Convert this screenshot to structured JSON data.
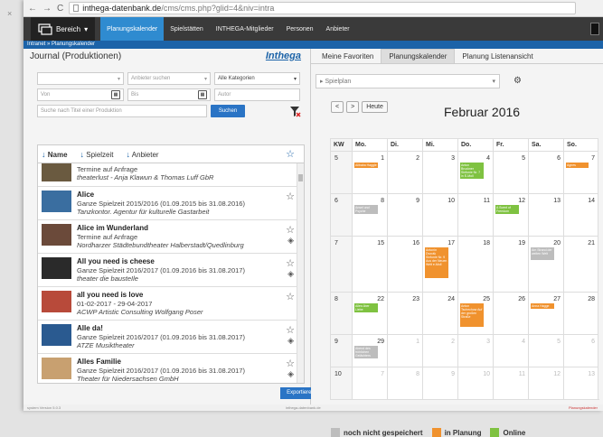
{
  "browser": {
    "url_domain": "inthega-datenbank.de",
    "url_path": "/cms/cms.php?glid=4&niv=intra",
    "close_glyph": "×"
  },
  "nav": {
    "brand_label": "Bereich",
    "items": [
      {
        "label": "Planungskalender",
        "active": true
      },
      {
        "label": "Spielstätten",
        "active": false
      },
      {
        "label": "INTHEGA-Mitglieder",
        "active": false
      },
      {
        "label": "Personen",
        "active": false
      },
      {
        "label": "Anbieter",
        "active": false
      }
    ]
  },
  "breadcrumb": "Intranet » Planungskalender",
  "journal": {
    "title": "Journal (Produktionen)",
    "logo": "Inthega",
    "filters": {
      "anbieter_placeholder": "Anbieter suchen",
      "kategorie_value": "Alle Kategorien",
      "von_placeholder": "Von",
      "bis_placeholder": "Bis",
      "autor_placeholder": "Autor",
      "titel_placeholder": "Suche nach Titel einer Produktion",
      "search_label": "Suchen"
    },
    "columns": {
      "name": "Name",
      "spielzeit": "Spielzeit",
      "anbieter": "Anbieter"
    },
    "items": [
      {
        "title": "",
        "line": "Termine auf Anfrage",
        "org": "theaterlust - Anja Klawun & Thomas Luff GbR",
        "thumb": "#6a5a40",
        "diamond": false
      },
      {
        "title": "Alice",
        "line": "Ganze Spielzeit 2015/2016 (01.09.2015 bis 31.08.2016)",
        "org": "Tanzkontor. Agentur für kulturelle Gastarbeit",
        "thumb": "#3a6ea0",
        "diamond": false
      },
      {
        "title": "Alice im Wunderland",
        "line": "Termine auf Anfrage",
        "org": "Nordharzer Städtebundtheater Halberstadt/Quedlinburg",
        "thumb": "#6b4a3a",
        "diamond": true
      },
      {
        "title": "All you need is cheese",
        "line": "Ganze Spielzeit 2016/2017 (01.09.2016 bis 31.08.2017)",
        "org": "theater die bausteIle",
        "thumb": "#2a2a2a",
        "diamond": true
      },
      {
        "title": "all you need is love",
        "line": "01-02-2017 - 29-04-2017",
        "org": "ACWP Artistic Consulting Wolfgang Poser",
        "thumb": "#b84a3a",
        "diamond": false
      },
      {
        "title": "Alle da!",
        "line": "Ganze Spielzeit 2016/2017 (01.09.2016 bis 31.08.2017)",
        "org": "ATZE Musiktheater",
        "thumb": "#2a5a90",
        "diamond": true
      },
      {
        "title": "Alles Familie",
        "line": "Ganze Spielzeit 2016/2017 (01.09.2016 bis 31.08.2017)",
        "org": "Theater für Niedersachsen GmbH",
        "thumb": "#c8a070",
        "diamond": true
      }
    ],
    "export_label": "Exportieren"
  },
  "calendar": {
    "tabs": [
      {
        "label": "Meine Favoriten",
        "active": false
      },
      {
        "label": "Planungskalender",
        "active": true
      },
      {
        "label": "Planung Listenansicht",
        "active": false
      }
    ],
    "spielplan_label": "Spielplan",
    "today_label": "Heute",
    "prev_glyph": "<",
    "next_glyph": ">",
    "month_title": "Februar 2016",
    "headers": [
      "KW",
      "Mo.",
      "Di.",
      "Mi.",
      "Do.",
      "Fr.",
      "Sa.",
      "So."
    ],
    "weeks": [
      {
        "kw": "5",
        "days": [
          "1",
          "2",
          "3",
          "4",
          "5",
          "6",
          "7"
        ],
        "dim": [
          false,
          false,
          false,
          false,
          false,
          false,
          false
        ]
      },
      {
        "kw": "6",
        "days": [
          "8",
          "9",
          "10",
          "11",
          "12",
          "13",
          "14"
        ],
        "dim": [
          false,
          false,
          false,
          false,
          false,
          false,
          false
        ]
      },
      {
        "kw": "7",
        "days": [
          "15",
          "16",
          "17",
          "18",
          "19",
          "20",
          "21"
        ],
        "dim": [
          false,
          false,
          false,
          false,
          false,
          false,
          false
        ]
      },
      {
        "kw": "8",
        "days": [
          "22",
          "23",
          "24",
          "25",
          "26",
          "27",
          "28"
        ],
        "dim": [
          false,
          false,
          false,
          false,
          false,
          false,
          false
        ]
      },
      {
        "kw": "9",
        "days": [
          "29",
          "1",
          "2",
          "3",
          "4",
          "5",
          "6"
        ],
        "dim": [
          false,
          true,
          true,
          true,
          true,
          true,
          true
        ]
      },
      {
        "kw": "10",
        "days": [
          "7",
          "8",
          "9",
          "10",
          "11",
          "12",
          "13"
        ],
        "dim": [
          true,
          true,
          true,
          true,
          true,
          true,
          true
        ]
      }
    ],
    "events": [
      {
        "week": 0,
        "day": 0,
        "text": "Alibaba Haggle",
        "status": "planning",
        "lines": 1
      },
      {
        "week": 0,
        "day": 3,
        "text": "Anton Bruckner Sinfonie Nr. 7 in E-Moll",
        "status": "online",
        "lines": 4
      },
      {
        "week": 0,
        "day": 6,
        "text": "Agnes",
        "status": "planning",
        "lines": 1
      },
      {
        "week": 1,
        "day": 0,
        "text": "Ansel und Psyche",
        "status": "unsaved",
        "lines": 2
      },
      {
        "week": 1,
        "day": 4,
        "text": "A Scent of Freedom",
        "status": "online",
        "lines": 2
      },
      {
        "week": 2,
        "day": 2,
        "text": "Antonín Dvorák Sinfonie Nr. 9 Aus der Neuen Welt e-Moll",
        "status": "planning",
        "lines": 8
      },
      {
        "week": 2,
        "day": 5,
        "text": "Am Strand der weiten Welt",
        "status": "unsaved",
        "lines": 3
      },
      {
        "week": 3,
        "day": 0,
        "text": "Alles über Liebe",
        "status": "online",
        "lines": 2
      },
      {
        "week": 3,
        "day": 3,
        "text": "Anton Tschechow Auf der großen Straße",
        "status": "planning",
        "lines": 6
      },
      {
        "week": 3,
        "day": 5,
        "text": "Anna Hagge",
        "status": "planning",
        "lines": 1
      },
      {
        "week": 4,
        "day": 0,
        "text": "Abend des fröhlichen Gelächters",
        "status": "unsaved",
        "lines": 3
      }
    ],
    "legend": [
      {
        "label": "noch nicht gespeichert",
        "color": "#bdbdbd"
      },
      {
        "label": "in Planung",
        "color": "#f0922e"
      },
      {
        "label": "Online",
        "color": "#7fc241"
      }
    ],
    "status_colors": {
      "unsaved": "#bdbdbd",
      "planning": "#f0922e",
      "online": "#7fc241"
    }
  },
  "footer": {
    "version": "system Version 5.0.3",
    "domain": "inthega-datenbank.de",
    "right": "Planungskalender"
  }
}
